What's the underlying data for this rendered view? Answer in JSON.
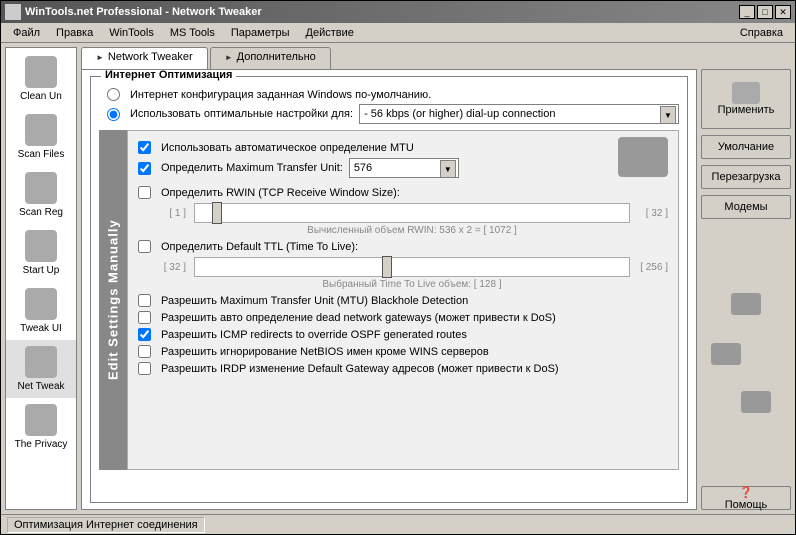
{
  "title": "WinTools.net Professional - Network Tweaker",
  "menu": {
    "file": "Файл",
    "edit": "Правка",
    "wintools": "WinTools",
    "mstools": "MS Tools",
    "params": "Параметры",
    "action": "Действие",
    "help": "Справка"
  },
  "sidebar": {
    "items": [
      {
        "label": "Clean Un"
      },
      {
        "label": "Scan Files"
      },
      {
        "label": "Scan Reg"
      },
      {
        "label": "Start Up"
      },
      {
        "label": "Tweak UI"
      },
      {
        "label": "Net Tweak"
      },
      {
        "label": "The Privacy"
      }
    ]
  },
  "tabs": {
    "main": "Network Tweaker",
    "extra": "Дополнительно"
  },
  "group": {
    "legend": "Интернет Оптимизация",
    "radio_default": "Интернет конфигурация заданная Windows по-умолчанию.",
    "radio_optimal": "Использовать оптимальные настройки для:",
    "conn_value": "- 56 kbps (or higher) dial-up connection"
  },
  "manual": {
    "band": "Edit Settings Manually",
    "auto_mtu": "Использовать автоматическое определение MTU",
    "define_mtu": "Определить Maximum Transfer Unit:",
    "mtu_value": "576",
    "define_rwin": "Определить RWIN (TCP Receive Window Size):",
    "rwin_min": "[ 1 ]",
    "rwin_max": "[ 32 ]",
    "rwin_calc": "Вычисленный объем RWIN: 536 x 2 = [ 1072 ]",
    "define_ttl": "Определить Default TTL (Time To Live):",
    "ttl_min": "[ 32 ]",
    "ttl_max": "[ 256 ]",
    "ttl_calc": "Выбранный Time To Live объем: [ 128 ]",
    "cb_blackhole": "Разрешить Maximum Transfer Unit (MTU) Blackhole Detection",
    "cb_deadgw": "Разрешить авто определение dead network gateways (может привести к DoS)",
    "cb_icmp": "Разрешить ICMP redirects to override OSPF generated routes",
    "cb_netbios": "Разрешить игнорирование NetBIOS имен кроме WINS серверов",
    "cb_irdp": "Разрешить IRDP изменение Default Gateway адресов (может привести к DoS)"
  },
  "buttons": {
    "apply": "Применить",
    "default": "Умолчание",
    "reboot": "Перезагрузка",
    "modems": "Модемы",
    "help": "Помощь"
  },
  "status": "Оптимизация Интернет соединения"
}
